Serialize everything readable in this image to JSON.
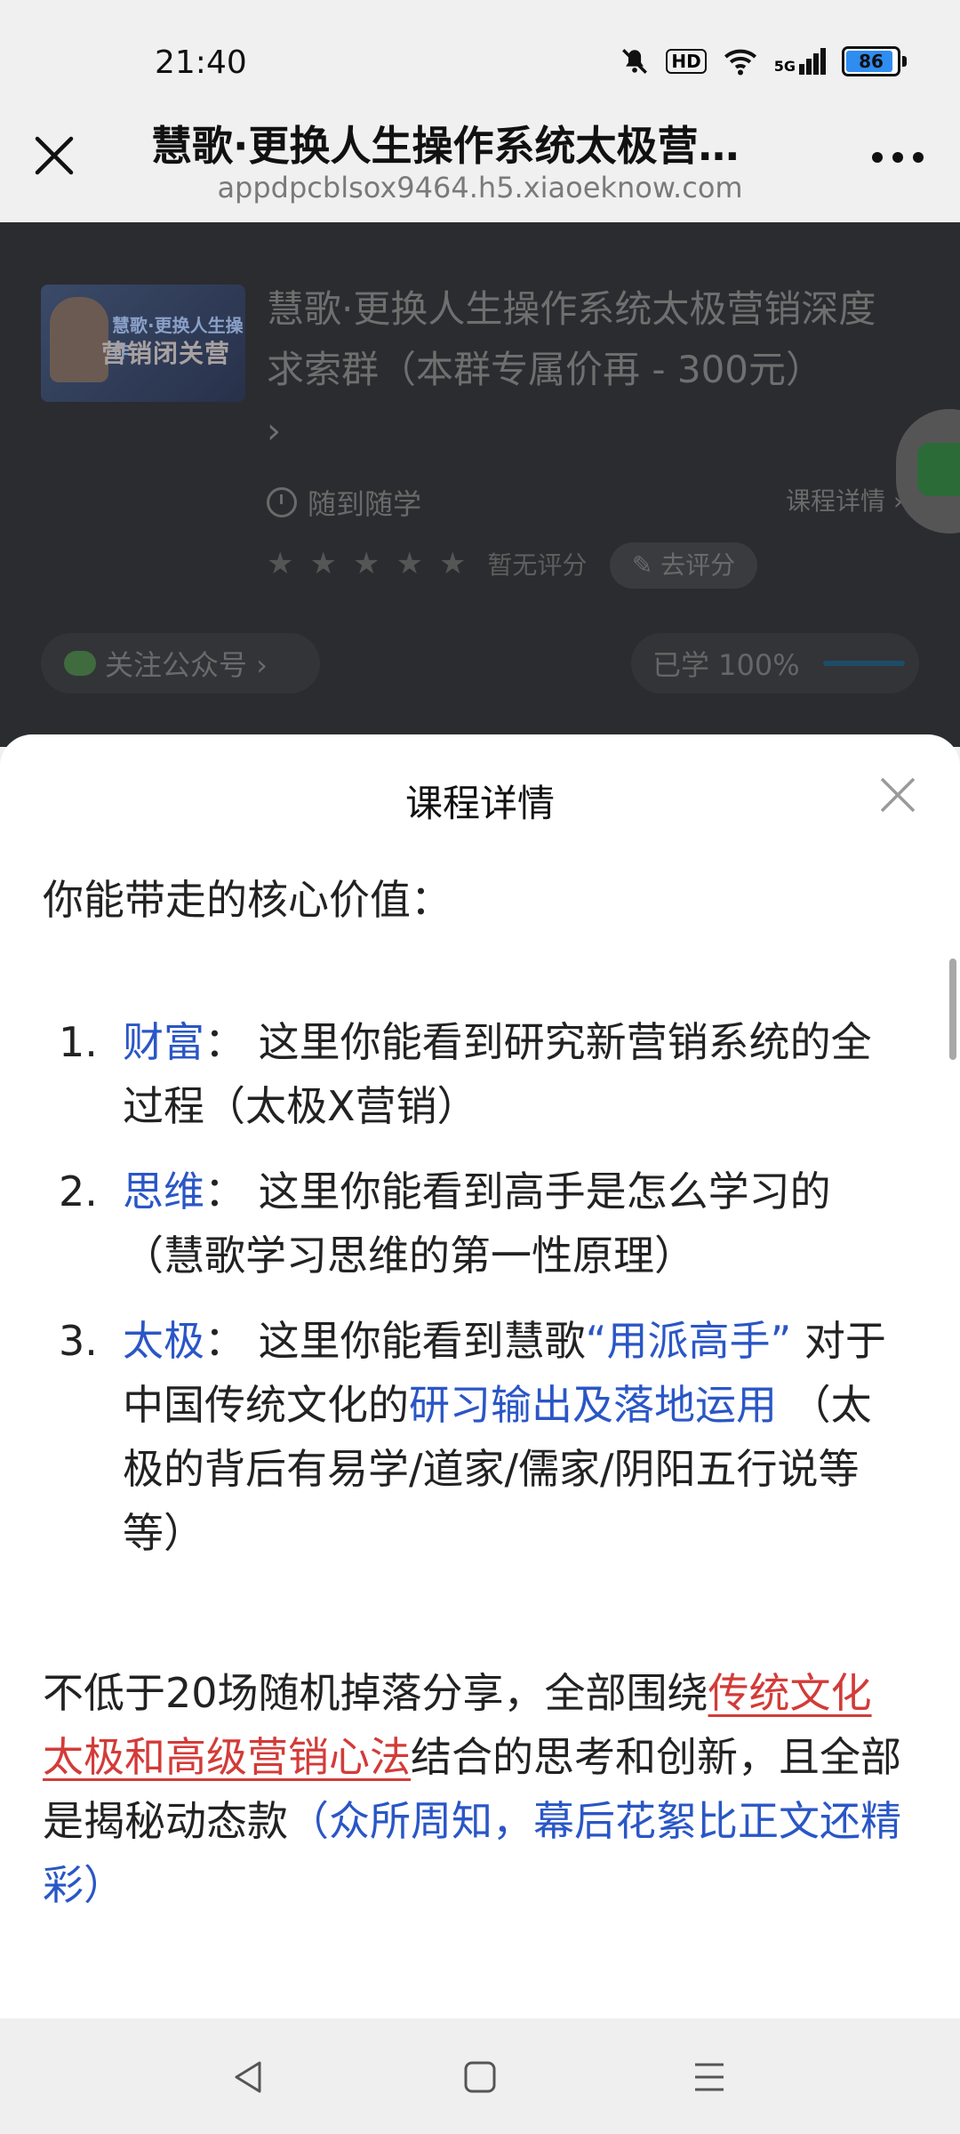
{
  "status_bar": {
    "time": "21:40",
    "hd": "HD",
    "network": "5G",
    "battery": "86"
  },
  "browser": {
    "title": "慧歌·更换人生操作系统太极营…",
    "url": "appdpcblsox9464.h5.xiaoeknow.com"
  },
  "course": {
    "thumbnail_line1": "慧歌·更换人生操作",
    "thumbnail_line2": "营销闭关营",
    "title": "慧歌·更换人生操作系统太极营销深度求索群（本群专属价再 - 300元）",
    "title_chevron": "›",
    "study_mode": "随到随学",
    "detail_link": "课程详情 ›",
    "rating_text": "暂无评分",
    "rate_button": "去评分",
    "follow_button": "关注公众号 ›",
    "progress_text": "已学 100%"
  },
  "sheet": {
    "title": "课程详情",
    "core_heading": "你能带走的核心价值：",
    "items": [
      {
        "num": "1.",
        "key": "财富",
        "text": "：  这里你能看到研究新营销系统的全过程（太极X营销）"
      },
      {
        "num": "2.",
        "key": "思维",
        "text": "：  这里你能看到高手是怎么学习的（慧歌学习思维的第一性原理）"
      },
      {
        "num": "3.",
        "key": "太极",
        "text_a": "：  这里你能看到慧歌",
        "highlight1": "“用派高手”",
        "text_b": " 对于中国传统文化的",
        "highlight2": "研习输出及落地运用",
        "text_c": " （太极的背后有易学/道家/儒家/阴阳五行说等等）"
      }
    ],
    "para_a": "不低于20场随机掉落分享，全部围绕",
    "para_red": "传统文化太极和高级营销心法",
    "para_b": "结合的思考和创新，且全部是揭秘动态款",
    "para_blue": "（众所周知，幕后花絮比正文还精彩）"
  }
}
